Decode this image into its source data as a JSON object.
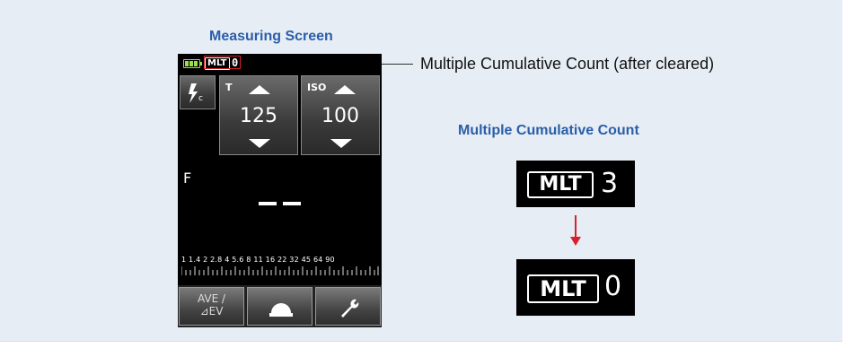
{
  "titles": {
    "measuring_screen": "Measuring Screen",
    "multiple_cumulative_count": "Multiple Cumulative Count"
  },
  "callout": {
    "text": "Multiple Cumulative Count (after cleared)"
  },
  "meter": {
    "status": {
      "mlt_badge": "MLT",
      "mlt_count": "0"
    },
    "flash_icon": "flash-cord-icon",
    "shutter": {
      "label": "T",
      "value": "125"
    },
    "iso": {
      "label": "ISO",
      "value": "100"
    },
    "aperture": {
      "label": "F",
      "value": "– –"
    },
    "scale": {
      "numbers": "1  1.4  2  2.8  4  5.6  8  11  16  22  32  45  64  90"
    },
    "bottom": {
      "ave_line1": "AVE /",
      "ave_line2": "⊿EV"
    }
  },
  "examples": {
    "before": {
      "badge": "MLT",
      "count": "3"
    },
    "after": {
      "badge": "MLT",
      "count": "0"
    }
  },
  "colors": {
    "panel_bg": "#e7edf5",
    "title_blue": "#2a5ea8",
    "highlight_red": "#d8202a",
    "battery_green": "#9be04a"
  }
}
